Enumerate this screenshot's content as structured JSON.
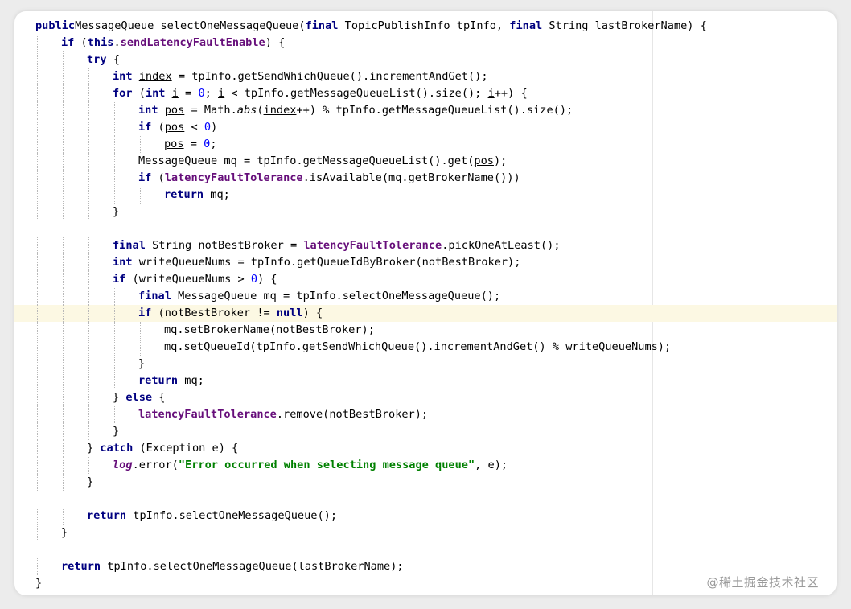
{
  "editor": {
    "language": "java",
    "highlighted_line": 17,
    "lines": [
      {
        "indent": 0,
        "parts": [
          [
            "kw",
            "public"
          ],
          [
            "",
            "MessageQueue selectOneMessageQueue("
          ],
          [
            "kw",
            "final"
          ],
          [
            "",
            " TopicPublishInfo tpInfo, "
          ],
          [
            "kw",
            "final"
          ],
          [
            "",
            " String lastBrokerName) {"
          ]
        ]
      },
      {
        "indent": 1,
        "parts": [
          [
            "kw",
            "if"
          ],
          [
            "",
            " ("
          ],
          [
            "kw",
            "this"
          ],
          [
            "",
            "."
          ],
          [
            "fld",
            "sendLatencyFaultEnable"
          ],
          [
            "",
            ") {"
          ]
        ]
      },
      {
        "indent": 2,
        "parts": [
          [
            "kw",
            "try"
          ],
          [
            "",
            " {"
          ]
        ]
      },
      {
        "indent": 3,
        "parts": [
          [
            "kw",
            "int"
          ],
          [
            "",
            " "
          ],
          [
            "ul",
            "index"
          ],
          [
            "",
            " = tpInfo.getSendWhichQueue().incrementAndGet();"
          ]
        ]
      },
      {
        "indent": 3,
        "parts": [
          [
            "kw",
            "for"
          ],
          [
            "",
            " ("
          ],
          [
            "kw",
            "int"
          ],
          [
            "",
            " "
          ],
          [
            "ul",
            "i"
          ],
          [
            "",
            " = "
          ],
          [
            "num",
            "0"
          ],
          [
            "",
            "; "
          ],
          [
            "ul",
            "i"
          ],
          [
            "",
            " < tpInfo.getMessageQueueList().size(); "
          ],
          [
            "ul",
            "i"
          ],
          [
            "",
            "++) {"
          ]
        ]
      },
      {
        "indent": 4,
        "parts": [
          [
            "kw",
            "int"
          ],
          [
            "",
            " "
          ],
          [
            "ul",
            "pos"
          ],
          [
            "",
            " = Math."
          ],
          [
            "it",
            "abs"
          ],
          [
            "",
            "("
          ],
          [
            "ul",
            "index"
          ],
          [
            "",
            "++) % tpInfo.getMessageQueueList().size();"
          ]
        ]
      },
      {
        "indent": 4,
        "parts": [
          [
            "kw",
            "if"
          ],
          [
            "",
            " ("
          ],
          [
            "ul",
            "pos"
          ],
          [
            "",
            " < "
          ],
          [
            "num",
            "0"
          ],
          [
            "",
            ")"
          ]
        ]
      },
      {
        "indent": 5,
        "parts": [
          [
            "ul",
            "pos"
          ],
          [
            "",
            " = "
          ],
          [
            "num",
            "0"
          ],
          [
            "",
            ";"
          ]
        ]
      },
      {
        "indent": 4,
        "parts": [
          [
            "",
            "MessageQueue mq = tpInfo.getMessageQueueList().get("
          ],
          [
            "ul",
            "pos"
          ],
          [
            "",
            ");"
          ]
        ]
      },
      {
        "indent": 4,
        "parts": [
          [
            "kw",
            "if"
          ],
          [
            "",
            " ("
          ],
          [
            "fld",
            "latencyFaultTolerance"
          ],
          [
            "",
            ".isAvailable(mq.getBrokerName()))"
          ]
        ]
      },
      {
        "indent": 5,
        "parts": [
          [
            "kw",
            "return"
          ],
          [
            "",
            " mq;"
          ]
        ]
      },
      {
        "indent": 3,
        "parts": [
          [
            "",
            "}"
          ]
        ]
      },
      {
        "indent": 0,
        "parts": []
      },
      {
        "indent": 3,
        "parts": [
          [
            "kw",
            "final"
          ],
          [
            "",
            " String notBestBroker = "
          ],
          [
            "fld",
            "latencyFaultTolerance"
          ],
          [
            "",
            ".pickOneAtLeast();"
          ]
        ]
      },
      {
        "indent": 3,
        "parts": [
          [
            "kw",
            "int"
          ],
          [
            "",
            " writeQueueNums = tpInfo.getQueueIdByBroker(notBestBroker);"
          ]
        ]
      },
      {
        "indent": 3,
        "parts": [
          [
            "kw",
            "if"
          ],
          [
            "",
            " (writeQueueNums > "
          ],
          [
            "num",
            "0"
          ],
          [
            "",
            ") {"
          ]
        ]
      },
      {
        "indent": 4,
        "parts": [
          [
            "kw",
            "final"
          ],
          [
            "",
            " MessageQueue mq = tpInfo.selectOneMessageQueue();"
          ]
        ]
      },
      {
        "indent": 4,
        "parts": [
          [
            "kw",
            "if"
          ],
          [
            "",
            " (notBestBroker != "
          ],
          [
            "kw",
            "null"
          ],
          [
            "",
            ") {"
          ]
        ]
      },
      {
        "indent": 5,
        "parts": [
          [
            "",
            "mq.setBrokerName(notBestBroker);"
          ]
        ]
      },
      {
        "indent": 5,
        "parts": [
          [
            "",
            "mq.setQueueId(tpInfo.getSendWhichQueue().incrementAndGet() % writeQueueNums);"
          ]
        ]
      },
      {
        "indent": 4,
        "parts": [
          [
            "",
            "}"
          ]
        ]
      },
      {
        "indent": 4,
        "parts": [
          [
            "kw",
            "return"
          ],
          [
            "",
            " mq;"
          ]
        ]
      },
      {
        "indent": 3,
        "parts": [
          [
            "",
            "} "
          ],
          [
            "kw",
            "else"
          ],
          [
            "",
            " {"
          ]
        ]
      },
      {
        "indent": 4,
        "parts": [
          [
            "fld",
            "latencyFaultTolerance"
          ],
          [
            "",
            ".remove(notBestBroker);"
          ]
        ]
      },
      {
        "indent": 3,
        "parts": [
          [
            "",
            "}"
          ]
        ]
      },
      {
        "indent": 2,
        "parts": [
          [
            "",
            "} "
          ],
          [
            "kw",
            "catch"
          ],
          [
            "",
            " (Exception e) {"
          ]
        ]
      },
      {
        "indent": 3,
        "parts": [
          [
            "stat",
            "log"
          ],
          [
            "",
            ".error("
          ],
          [
            "str",
            "\"Error occurred when selecting message queue\""
          ],
          [
            "",
            ", e);"
          ]
        ]
      },
      {
        "indent": 2,
        "parts": [
          [
            "",
            "}"
          ]
        ]
      },
      {
        "indent": 0,
        "parts": []
      },
      {
        "indent": 2,
        "parts": [
          [
            "kw",
            "return"
          ],
          [
            "",
            " tpInfo.selectOneMessageQueue();"
          ]
        ]
      },
      {
        "indent": 1,
        "parts": [
          [
            "",
            "}"
          ]
        ]
      },
      {
        "indent": 0,
        "parts": []
      },
      {
        "indent": 1,
        "parts": [
          [
            "kw",
            "return"
          ],
          [
            "",
            " tpInfo.selectOneMessageQueue(lastBrokerName);"
          ]
        ]
      },
      {
        "indent": 0,
        "parts": [
          [
            "",
            "}"
          ]
        ]
      }
    ]
  },
  "watermark": "@稀土掘金技术社区",
  "colors": {
    "keyword": "#000080",
    "field": "#660e7a",
    "number": "#0000ff",
    "string": "#008000",
    "current_line": "#fcf8e3"
  }
}
